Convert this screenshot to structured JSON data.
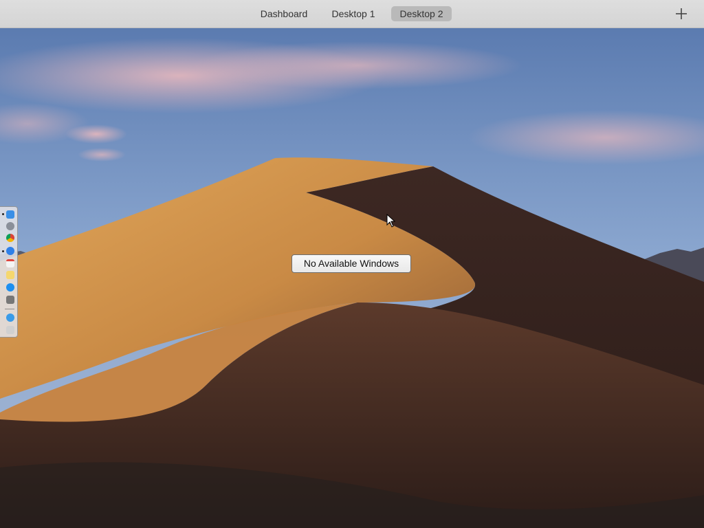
{
  "spaces_bar": {
    "tabs": [
      {
        "label": "Dashboard",
        "selected": false
      },
      {
        "label": "Desktop 1",
        "selected": false
      },
      {
        "label": "Desktop 2",
        "selected": true
      }
    ],
    "add_icon": "plus-icon"
  },
  "main": {
    "empty_label": "No Available Windows"
  },
  "dock": {
    "items": [
      {
        "icon": "finder-icon",
        "running": true,
        "color": "#3b8fe6"
      },
      {
        "icon": "launchpad-icon",
        "running": false,
        "color": "#8a8f99"
      },
      {
        "icon": "chrome-icon",
        "running": false,
        "color": "#db4437"
      },
      {
        "icon": "safari-icon",
        "running": true,
        "color": "#2f80e8"
      },
      {
        "icon": "calendar-icon",
        "running": false,
        "color": "#f4f4f4"
      },
      {
        "icon": "notes-icon",
        "running": false,
        "color": "#f5d76e"
      },
      {
        "icon": "app-store-icon",
        "running": false,
        "color": "#1d8ff0"
      },
      {
        "icon": "screenshot-icon",
        "running": false,
        "color": "#777777"
      },
      {
        "icon": "downloads-folder-icon",
        "running": false,
        "color": "#3a9be8"
      },
      {
        "icon": "trash-icon",
        "running": false,
        "color": "#d0d0d0"
      }
    ]
  },
  "colors": {
    "spaces_bar_bg": "#d8d8d8",
    "selected_tab_bg": "#b9b9b9",
    "sky_top": "#5f7fb3",
    "dune_light": "#d99a4e",
    "dune_shadow": "#3a2722"
  }
}
